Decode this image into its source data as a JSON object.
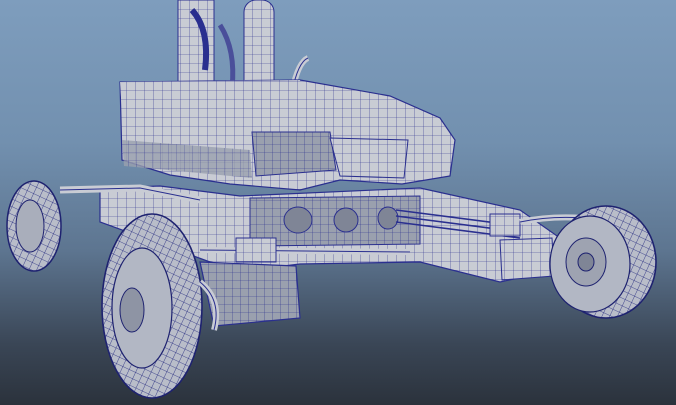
{
  "viewport": {
    "background_top": "#7e9dbd",
    "background_bottom": "#2b323c"
  },
  "model": {
    "surface_color": "#c9ccd4",
    "shadow_color": "#8d93a2",
    "wire_color": "#2a2f8f",
    "tire_color": "#b9bdc9"
  }
}
